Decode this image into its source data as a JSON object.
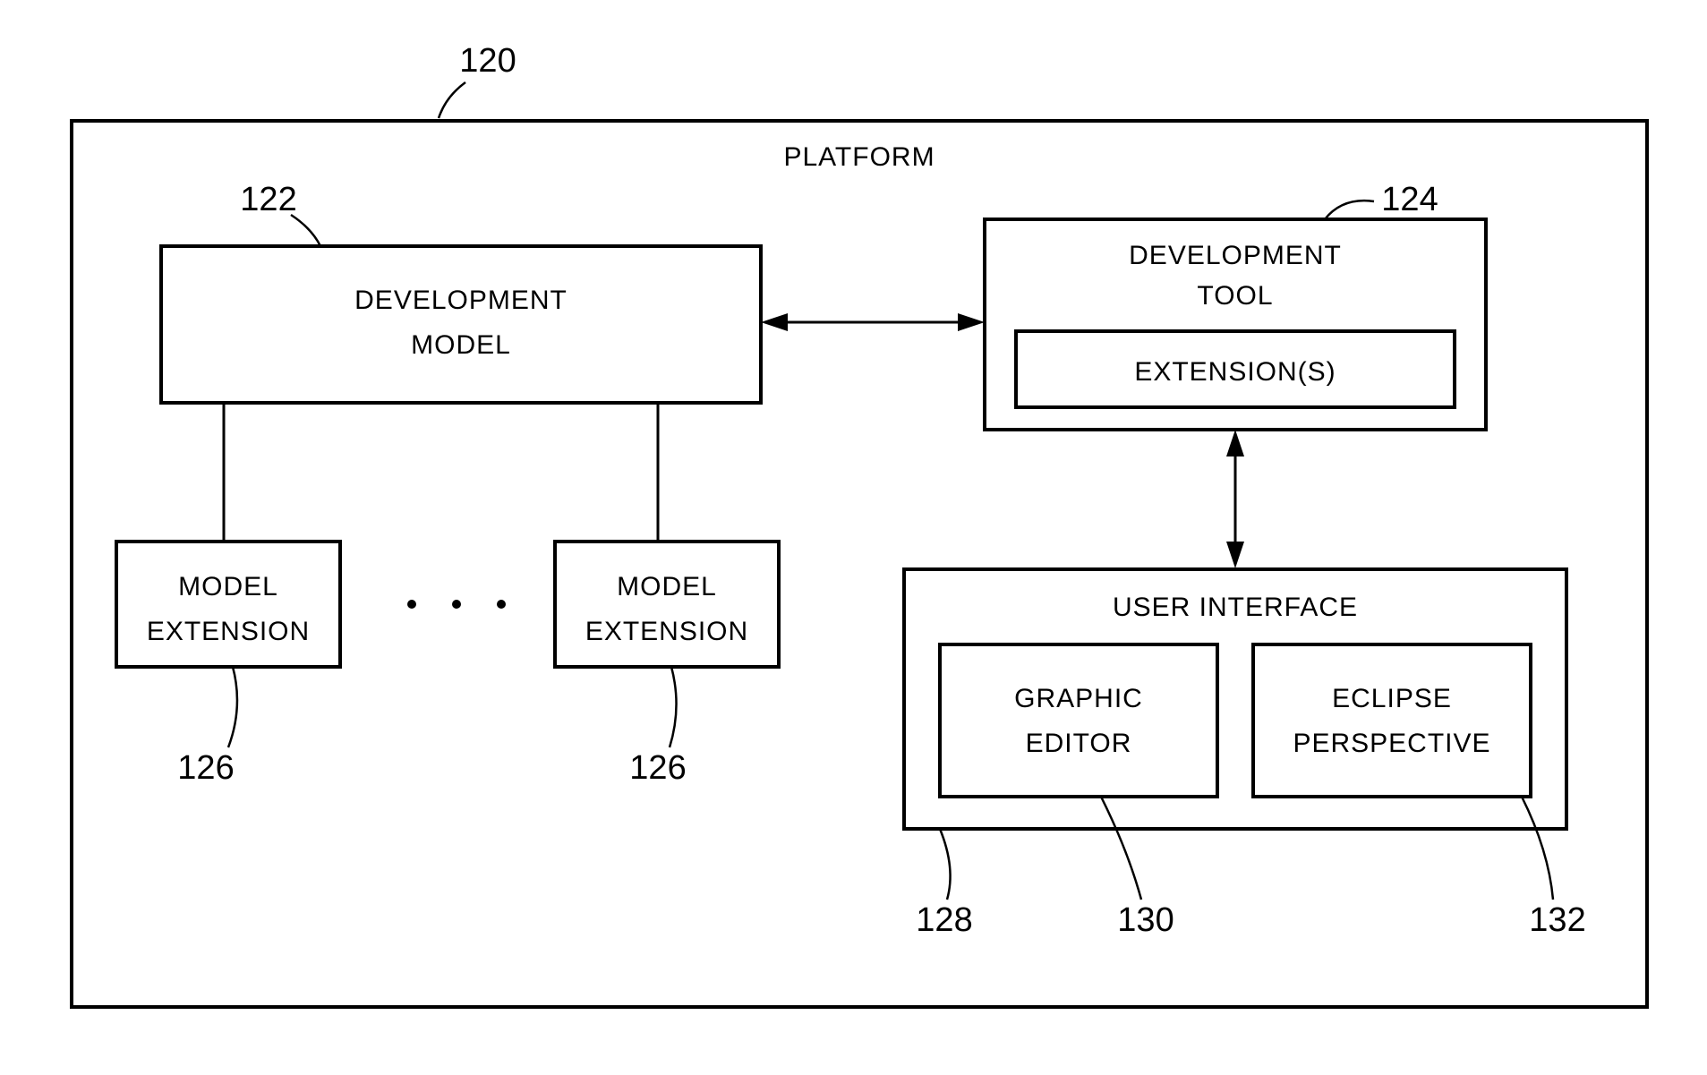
{
  "diagram": {
    "platform_label": "PLATFORM",
    "platform_ref": "120",
    "dev_model_label1": "DEVELOPMENT",
    "dev_model_label2": "MODEL",
    "dev_model_ref": "122",
    "model_ext_label1": "MODEL",
    "model_ext_label2": "EXTENSION",
    "model_ext_ref": "126",
    "dev_tool_label1": "DEVELOPMENT",
    "dev_tool_label2": "TOOL",
    "dev_tool_ref": "124",
    "extensions_label": "EXTENSION(S)",
    "ui_label": "USER INTERFACE",
    "ui_ref": "128",
    "graphic_editor_label1": "GRAPHIC",
    "graphic_editor_label2": "EDITOR",
    "graphic_editor_ref": "130",
    "eclipse_label1": "ECLIPSE",
    "eclipse_label2": "PERSPECTIVE",
    "eclipse_ref": "132"
  }
}
